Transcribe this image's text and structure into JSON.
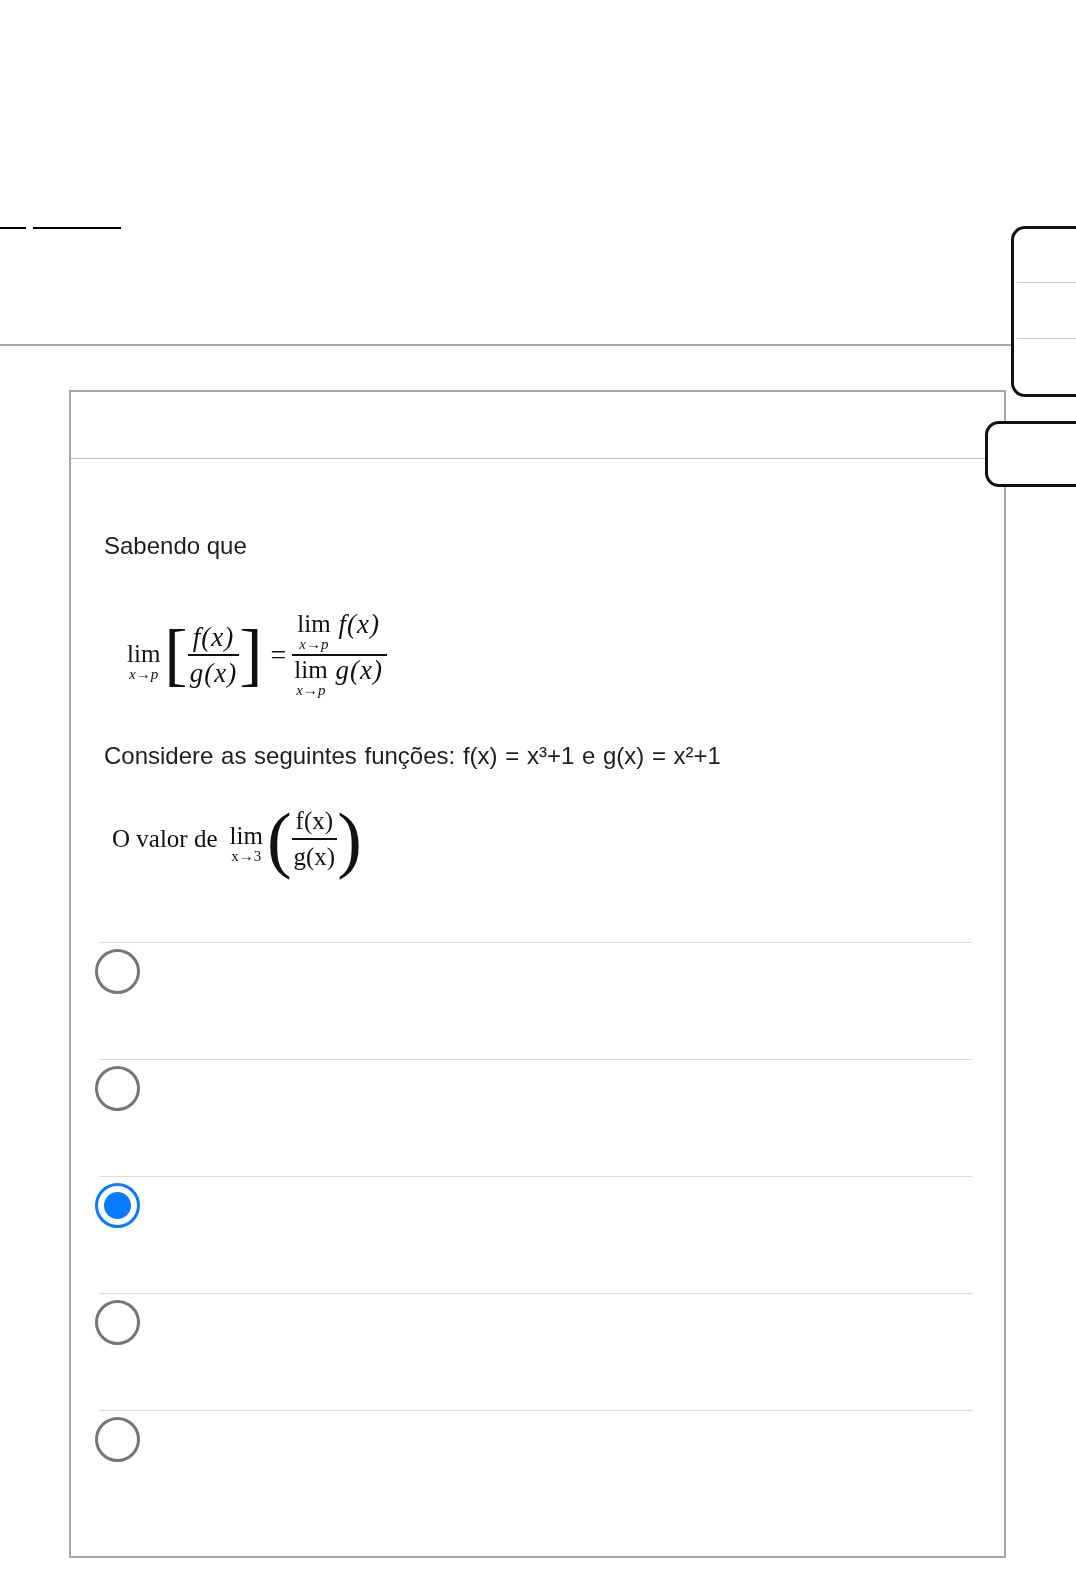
{
  "card": {
    "question": {
      "intro": "Sabendo que",
      "quotient_rule": {
        "lhs": {
          "operator": "lim",
          "subscript": "x→p",
          "open_bracket": "[",
          "numerator": "f(x)",
          "denominator": "g(x)",
          "close_bracket": "]"
        },
        "relation": "=",
        "rhs": {
          "numerator": {
            "operator": "lim",
            "subscript": "x→p",
            "argument": "f(x)"
          },
          "denominator": {
            "operator": "lim",
            "subscript": "x→p",
            "argument": "g(x)"
          }
        }
      },
      "functions_text": "Considere as seguintes funções: f(x) = x³+1 e g(x) = x²+1",
      "prompt": {
        "text": "O valor de",
        "operator": "lim",
        "subscript": "x→3",
        "open_paren": "(",
        "numerator": "f(x)",
        "denominator": "g(x)",
        "close_paren": ")"
      }
    },
    "options": [
      {
        "selected": false
      },
      {
        "selected": false
      },
      {
        "selected": true
      },
      {
        "selected": false
      },
      {
        "selected": false
      }
    ]
  }
}
